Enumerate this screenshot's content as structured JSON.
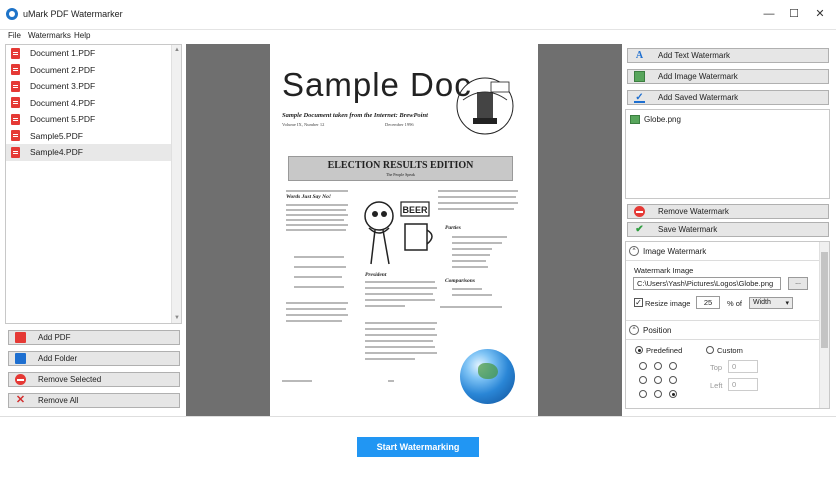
{
  "window": {
    "title": "uMark PDF Watermarker",
    "controls": {
      "minimize": "—",
      "maximize": "☐",
      "close": "✕"
    }
  },
  "menu": [
    "File",
    "Watermarks",
    "Help"
  ],
  "documents": [
    {
      "name": "Document 1.PDF"
    },
    {
      "name": "Document 2.PDF"
    },
    {
      "name": "Document 3.PDF"
    },
    {
      "name": "Document 4.PDF"
    },
    {
      "name": "Document 5.PDF"
    },
    {
      "name": "Sample5.PDF"
    },
    {
      "name": "Sample4.PDF"
    }
  ],
  "left_buttons": {
    "add_pdf": "Add PDF",
    "add_folder": "Add Folder",
    "remove_selected": "Remove Selected",
    "remove_all": "Remove All"
  },
  "preview": {
    "title": "Sample Doc",
    "subtitle": "Sample Document taken from the Internet: BrewPoint",
    "volume": "Volume IX, Number 12",
    "date": "December 1996",
    "banner": "ELECTION RESULTS EDITION",
    "banner_sub": "The People Speak",
    "col_head_1": "Words Just Say No!",
    "col_head_2": "President",
    "col_head_3": "Parties",
    "col_head_4": "Comparisons"
  },
  "right_buttons": {
    "add_text": "Add Text Watermark",
    "add_image": "Add Image Watermark",
    "add_saved": "Add Saved Watermark",
    "remove": "Remove Watermark",
    "save": "Save Watermark"
  },
  "watermarks": [
    {
      "name": "Globe.png"
    }
  ],
  "image_section": {
    "header": "Image Watermark",
    "label": "Watermark Image",
    "path": "C:\\Users\\Yash\\Pictures\\Logos\\Globe.png",
    "browse": "...",
    "resize_label": "Resize image",
    "resize_value": "25",
    "percent_of": "% of",
    "dimension": "Width"
  },
  "position_section": {
    "header": "Position",
    "predefined": "Predefined",
    "custom": "Custom",
    "top_label": "Top",
    "top_value": "0",
    "left_label": "Left",
    "left_value": "0"
  },
  "start_button": "Start Watermarking"
}
